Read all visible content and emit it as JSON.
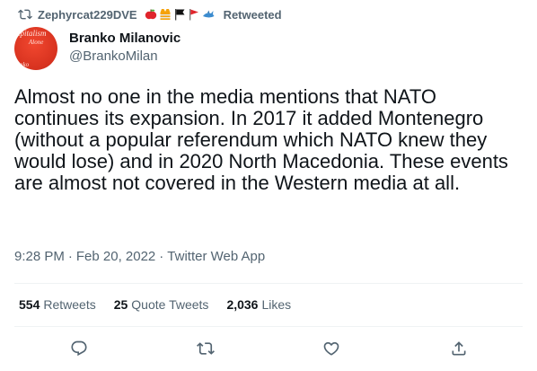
{
  "retweet": {
    "user": "Zephyrcat229DVE",
    "suffix": "Retweeted",
    "emojis": [
      "apple-icon",
      "vest-icon",
      "black-flag-icon",
      "red-flag-icon",
      "shark-icon"
    ]
  },
  "author": {
    "name": "Branko Milanovic",
    "handle": "@BrankoMilan"
  },
  "tweet": {
    "text": "Almost no one in the media mentions that NATO continues its expansion. In 2017 it added Montenegro (without a popular referendum which NATO knew they would lose) and in 2020 North Macedonia. These events are almost not covered in the Western media at all."
  },
  "meta": {
    "time": "9:28 PM",
    "sep1": "·",
    "date": "Feb 20, 2022",
    "sep2": "·",
    "source": "Twitter Web App"
  },
  "stats": {
    "retweets": {
      "count": "554",
      "label": "Retweets"
    },
    "quotes": {
      "count": "25",
      "label": "Quote Tweets"
    },
    "likes": {
      "count": "2,036",
      "label": "Likes"
    }
  },
  "colors": {
    "text": "#0f1419",
    "secondary": "#536471",
    "divider": "#eff3f4"
  }
}
